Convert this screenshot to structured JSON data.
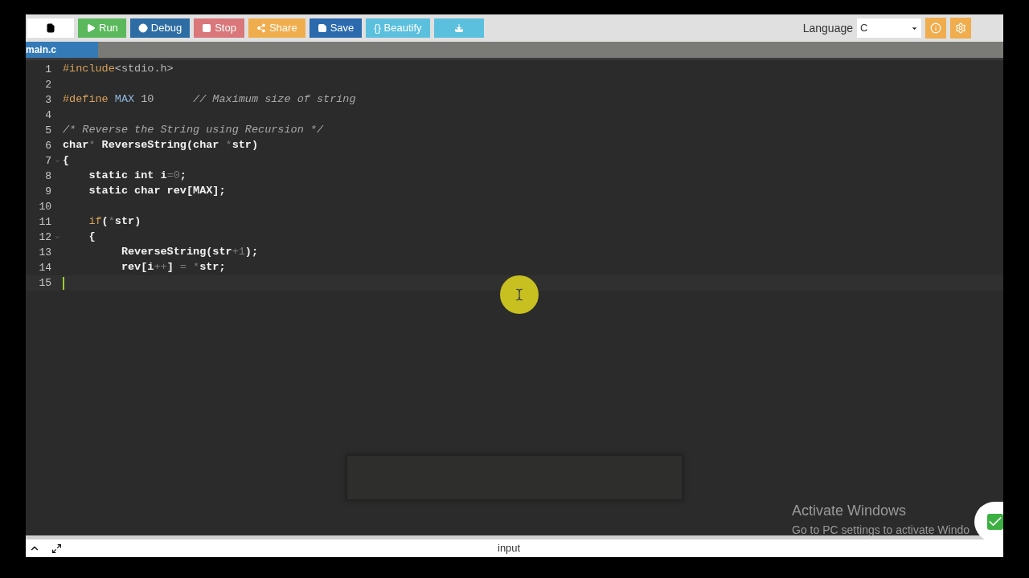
{
  "toolbar": {
    "buttons": [
      {
        "kind": "run",
        "label": "Run",
        "color": "#5cb85c"
      },
      {
        "kind": "debug",
        "label": "Debug",
        "color": "#2e6da4"
      },
      {
        "kind": "stop",
        "label": "Stop",
        "color": "#d9777a"
      },
      {
        "kind": "share",
        "label": "Share",
        "color": "#f0ad4e"
      },
      {
        "kind": "save",
        "label": "Save",
        "color": "#2a6aad"
      },
      {
        "kind": "beautify",
        "label": "{} Beautify",
        "color": "#5bc0de"
      },
      {
        "kind": "download",
        "color": "#5bc0de"
      }
    ],
    "language": {
      "label": "Language",
      "value": "C"
    }
  },
  "tabs": [
    {
      "label": "main.c",
      "selected": true
    }
  ],
  "editor": {
    "lines": [
      {
        "number": "1",
        "fold": false,
        "active": false,
        "tokens": [
          {
            "text": "#include",
            "kind": "meta"
          },
          {
            "text": "<stdio.h>",
            "kind": "string"
          }
        ]
      },
      {
        "number": "2",
        "fold": false,
        "active": false
      },
      {
        "number": "3",
        "fold": false,
        "active": false,
        "tokens": [
          {
            "text": "#define ",
            "kind": "meta"
          },
          {
            "text": "MAX ",
            "kind": "constant"
          },
          {
            "text": "10",
            "kind": "string"
          },
          {
            "text": "      // Maximum size of string",
            "kind": "comment"
          }
        ]
      },
      {
        "number": "4",
        "fold": false,
        "active": false
      },
      {
        "number": "5",
        "fold": false,
        "active": false,
        "tokens": [
          {
            "text": "/* Reverse the String using Recursion */",
            "kind": "comment"
          }
        ]
      },
      {
        "number": "6",
        "fold": false,
        "active": false,
        "tokens": [
          {
            "text": "char",
            "kind": "plain"
          },
          {
            "text": "*",
            "kind": "operator"
          },
          {
            "text": " ReverseString(char ",
            "kind": "plain"
          },
          {
            "text": "*",
            "kind": "operator"
          },
          {
            "text": "str)",
            "kind": "plain"
          }
        ]
      },
      {
        "number": "7",
        "fold": true,
        "active": false,
        "tokens": [
          {
            "text": "{",
            "kind": "plain"
          }
        ]
      },
      {
        "number": "8",
        "fold": false,
        "active": false,
        "tokens": [
          {
            "text": "    static int i",
            "kind": "plain"
          },
          {
            "text": "=0",
            "kind": "operator"
          },
          {
            "text": ";",
            "kind": "plain"
          }
        ]
      },
      {
        "number": "9",
        "fold": false,
        "active": false,
        "tokens": [
          {
            "text": "    static char rev[MAX];",
            "kind": "plain"
          }
        ]
      },
      {
        "number": "10",
        "fold": false,
        "active": false
      },
      {
        "number": "11",
        "fold": false,
        "active": false,
        "tokens": [
          {
            "text": "    if",
            "kind": "meta"
          },
          {
            "text": "(",
            "kind": "plain"
          },
          {
            "text": "*",
            "kind": "operator"
          },
          {
            "text": "str)",
            "kind": "plain"
          }
        ]
      },
      {
        "number": "12",
        "fold": true,
        "active": false,
        "tokens": [
          {
            "text": "    {",
            "kind": "plain"
          }
        ]
      },
      {
        "number": "13",
        "fold": false,
        "active": false,
        "tokens": [
          {
            "text": "         ReverseString(str",
            "kind": "plain"
          },
          {
            "text": "+1",
            "kind": "operator"
          },
          {
            "text": ");",
            "kind": "plain"
          }
        ]
      },
      {
        "number": "14",
        "fold": false,
        "active": false,
        "tokens": [
          {
            "text": "         rev[i",
            "kind": "plain"
          },
          {
            "text": "++",
            "kind": "operator"
          },
          {
            "text": "] ",
            "kind": "plain"
          },
          {
            "text": "=",
            "kind": "operator"
          },
          {
            "text": " *",
            "kind": "operator"
          },
          {
            "text": "str;",
            "kind": "plain"
          }
        ]
      },
      {
        "number": "15",
        "fold": false,
        "active": true
      }
    ]
  },
  "activation_notice": {
    "title": "Activate Windows",
    "text": "Go to PC settings to activate Windo"
  },
  "bottom_bar": {
    "label": "input"
  }
}
